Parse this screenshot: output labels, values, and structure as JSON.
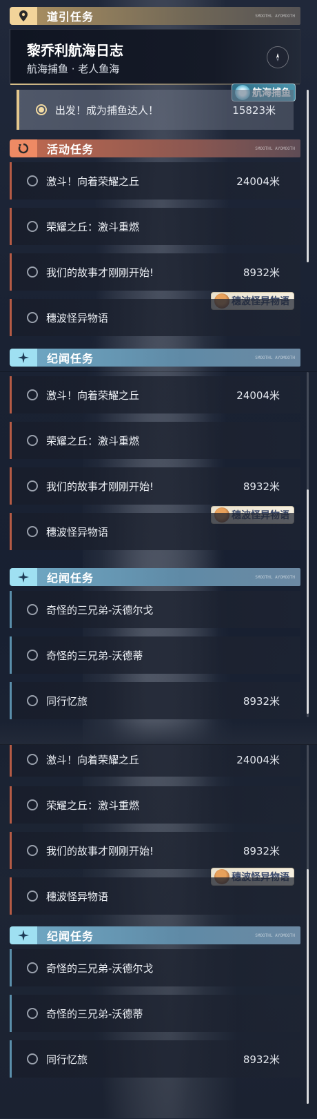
{
  "guide": {
    "header": "道引任务",
    "tag": "SMOOTHL AYOMOOTH",
    "card_title": "黎乔利航海日志",
    "card_sub": "航海捕鱼 · 老人鱼海",
    "chip": "航海捕鱼",
    "selected_label": "出发！成为捕鱼达人！",
    "selected_dist": "15823米"
  },
  "activity": {
    "header": "活动任务",
    "tag": "SMOOTHL AYOMOOTH",
    "chip": "穗波怪异物语",
    "items": [
      {
        "label": "激斗！向着荣耀之丘",
        "dist": "24004米"
      },
      {
        "label": "荣耀之丘：激斗重燃",
        "dist": ""
      },
      {
        "label": "我们的故事才刚刚开始!",
        "dist": "8932米"
      },
      {
        "label": "穗波怪异物语",
        "dist": ""
      }
    ]
  },
  "lore": {
    "header": "纪闻任务",
    "tag": "SMOOTHL AYOMOOTH",
    "items": [
      {
        "label": "奇怪的三兄弟-沃德尔戈",
        "dist": ""
      },
      {
        "label": "奇怪的三兄弟-沃德蒂",
        "dist": ""
      },
      {
        "label": "同行忆旅",
        "dist": "8932米"
      }
    ]
  },
  "colors": {
    "guide": "#f2d49a",
    "activity": "#ee8a64",
    "lore": "#9fe0f2"
  },
  "icons": {
    "guide": "location-pin-icon",
    "activity": "refresh-arrow-icon",
    "lore": "sparkle-star-icon"
  }
}
